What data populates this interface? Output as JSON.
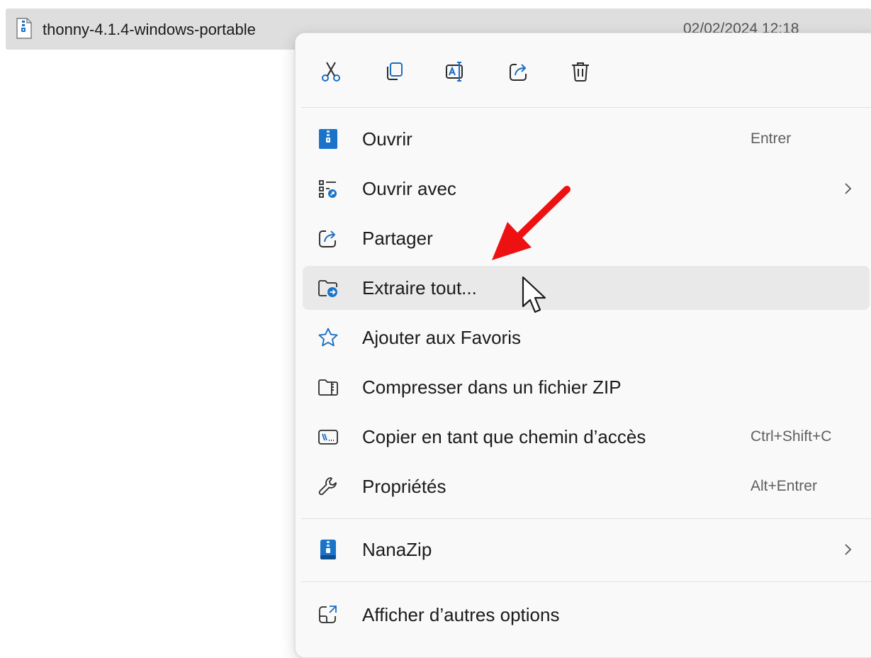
{
  "file": {
    "name": "thonny-4.1.4-windows-portable",
    "date": "02/02/2024 12:18"
  },
  "toolbar": [
    {
      "id": "cut",
      "icon": "scissors-icon"
    },
    {
      "id": "copy",
      "icon": "copy-icon"
    },
    {
      "id": "rename",
      "icon": "rename-icon"
    },
    {
      "id": "share",
      "icon": "share-icon"
    },
    {
      "id": "delete",
      "icon": "trash-icon"
    }
  ],
  "menu": {
    "open": {
      "label": "Ouvrir",
      "shortcut": "Entrer",
      "icon": "zip-file-icon"
    },
    "open_with": {
      "label": "Ouvrir avec",
      "icon": "open-with-icon"
    },
    "share": {
      "label": "Partager",
      "icon": "share-icon"
    },
    "extract_all": {
      "label": "Extraire tout...",
      "icon": "extract-folder-icon"
    },
    "favorites": {
      "label": "Ajouter aux Favoris",
      "icon": "star-icon"
    },
    "compress": {
      "label": "Compresser dans un fichier ZIP",
      "icon": "zip-folder-icon"
    },
    "copy_path": {
      "label": "Copier en tant que chemin d’accès",
      "shortcut": "Ctrl+Shift+C",
      "icon": "copy-path-icon"
    },
    "properties": {
      "label": "Propriétés",
      "shortcut": "Alt+Entrer",
      "icon": "wrench-icon"
    },
    "nanazip": {
      "label": "NanaZip",
      "icon": "nanazip-icon"
    },
    "more_options": {
      "label": "Afficher d’autres options",
      "icon": "more-options-icon"
    }
  },
  "colors": {
    "accent": "#0067c0",
    "highlight_row": "#dedede",
    "menu_bg": "#f9f9f9",
    "hover_bg": "#e9e9e9",
    "annotation_arrow": "#ee1111"
  }
}
